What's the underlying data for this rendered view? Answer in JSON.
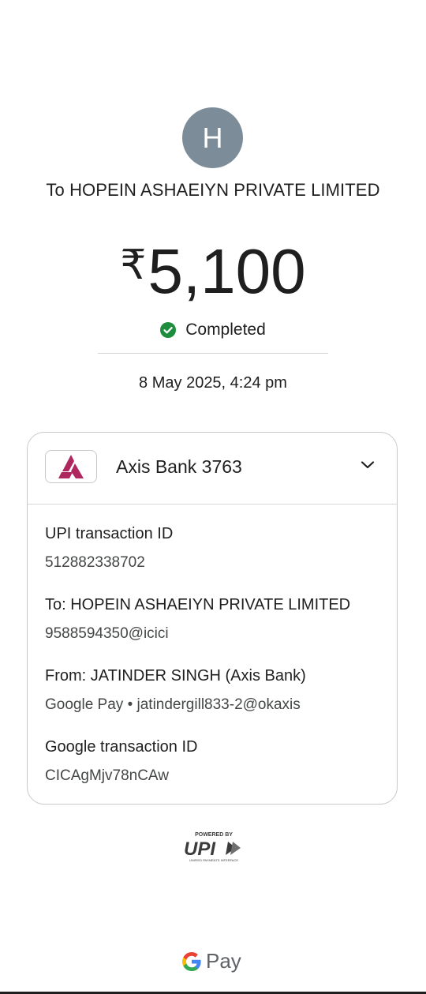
{
  "recipient": {
    "avatar_initial": "H",
    "title": "To HOPEIN ASHAEIYN PRIVATE LIMITED"
  },
  "payment": {
    "currency_symbol": "₹",
    "amount": "5,100",
    "status": "Completed",
    "datetime": "8 May 2025, 4:24 pm"
  },
  "account": {
    "bank_name": "Axis Bank 3763",
    "logo_color": "#ae275f"
  },
  "details": [
    {
      "label": "UPI transaction ID",
      "value": "512882338702"
    },
    {
      "label": "To: HOPEIN ASHAEIYN PRIVATE LIMITED",
      "value": "9588594350@icici"
    },
    {
      "label": "From: JATINDER SINGH (Axis Bank)",
      "value": "Google Pay • jatindergill833-2@okaxis"
    },
    {
      "label": "Google transaction ID",
      "value": "CICAgMjv78nCAw"
    }
  ],
  "footer": {
    "powered_by": "POWERED BY",
    "upi_text": "UPI",
    "upi_subtext": "UNIFIED PAYMENTS INTERFACE",
    "brand_text": "Pay"
  },
  "colors": {
    "success": "#1e8e3e",
    "avatar_bg": "#7c8d99"
  }
}
